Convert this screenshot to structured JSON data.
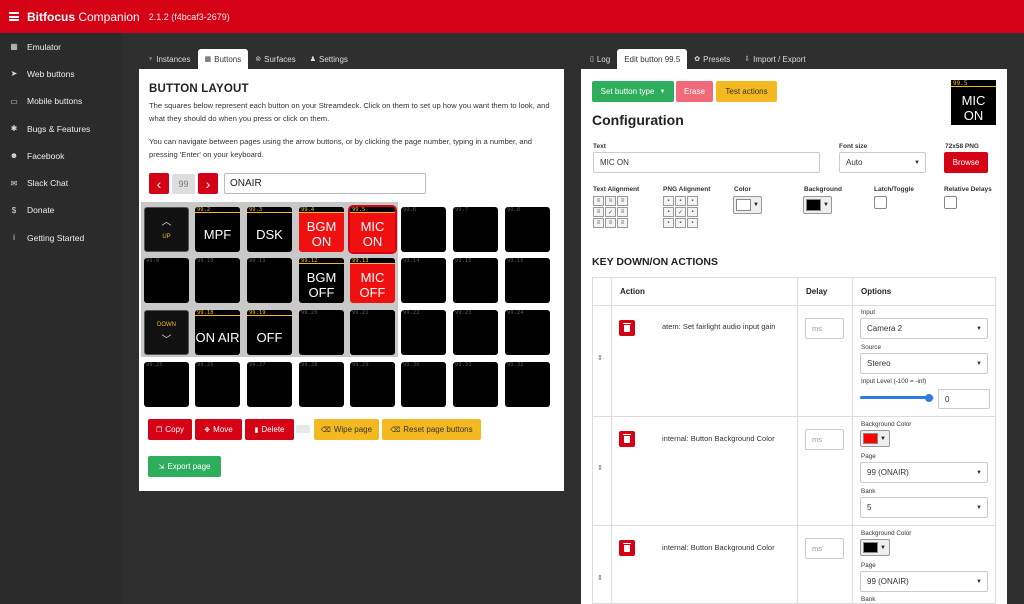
{
  "app": {
    "brand_bold": "Bitfocus",
    "brand_rest": " Companion",
    "version": "2.1.2 (f4bcaf3-2679)"
  },
  "sidebar": {
    "items": [
      {
        "label": "Emulator",
        "icon": "grid-icon",
        "glyph": "▦"
      },
      {
        "label": "Web buttons",
        "icon": "pointer-icon",
        "glyph": "➤"
      },
      {
        "label": "Mobile buttons",
        "icon": "tablet-icon",
        "glyph": "▭"
      },
      {
        "label": "Bugs & Features",
        "icon": "bug-icon",
        "glyph": "✱"
      },
      {
        "label": "Facebook",
        "icon": "users-icon",
        "glyph": "☻"
      },
      {
        "label": "Slack Chat",
        "icon": "comments-icon",
        "glyph": "✉"
      },
      {
        "label": "Donate",
        "icon": "dollar-icon",
        "glyph": "$"
      },
      {
        "label": "Getting Started",
        "icon": "info-icon",
        "glyph": "i"
      }
    ]
  },
  "left_tabs": [
    {
      "label": "Instances",
      "icon": "plug-icon",
      "glyph": "♆"
    },
    {
      "label": "Buttons",
      "icon": "calculator-icon",
      "glyph": "▦",
      "active": true
    },
    {
      "label": "Surfaces",
      "icon": "gamepad-icon",
      "glyph": "⊚"
    },
    {
      "label": "Settings",
      "icon": "user-cog-icon",
      "glyph": "♟"
    }
  ],
  "right_tabs": [
    {
      "label": "Log",
      "icon": "file-icon",
      "glyph": "▯"
    },
    {
      "label": "Edit button 99.5",
      "icon": "",
      "glyph": "",
      "active": true
    },
    {
      "label": "Presets",
      "icon": "gift-icon",
      "glyph": "✿"
    },
    {
      "label": "Import / Export",
      "icon": "download-icon",
      "glyph": "⇩"
    }
  ],
  "button_layout": {
    "title": "BUTTON LAYOUT",
    "para1": "The squares below represent each button on your Streamdeck. Click on them to set up how you want them to look, and what they should do when you press or click on them.",
    "para2": "You can navigate between pages using the arrow buttons, or by clicking the page number, typing in a number, and pressing 'Enter' on your keyboard.",
    "page_number": "99",
    "page_name": "ONAIR",
    "prev_glyph": "‹",
    "next_glyph": "›",
    "copy": "Copy",
    "move": "Move",
    "delete": "Delete",
    "wipe": "Wipe page",
    "reset": "Reset page buttons",
    "export": "Export page",
    "nav_up": "UP",
    "nav_down": "DOWN",
    "chev_up": "︿",
    "chev_down": "﹀"
  },
  "keys": [
    {
      "num": "",
      "label": "",
      "type": "nav-up"
    },
    {
      "num": "99.2",
      "label": "MPF",
      "lit": true
    },
    {
      "num": "99.3",
      "label": "DSK",
      "lit": true
    },
    {
      "num": "99.4",
      "label": "BGM ON",
      "lit": true,
      "red": true
    },
    {
      "num": "99.5",
      "label": "MIC ON",
      "lit": true,
      "red": true
    },
    {
      "num": "99.6",
      "label": ""
    },
    {
      "num": "99.7",
      "label": ""
    },
    {
      "num": "99.8",
      "label": ""
    },
    {
      "num": "99.9",
      "label": ""
    },
    {
      "num": "99.10",
      "label": ""
    },
    {
      "num": "99.11",
      "label": ""
    },
    {
      "num": "99.12",
      "label": "BGM OFF",
      "lit": true
    },
    {
      "num": "99.13",
      "label": "MIC OFF",
      "lit": true,
      "red": true
    },
    {
      "num": "99.14",
      "label": ""
    },
    {
      "num": "99.15",
      "label": ""
    },
    {
      "num": "99.16",
      "label": ""
    },
    {
      "num": "",
      "label": "",
      "type": "nav-down"
    },
    {
      "num": "99.18",
      "label": "ON AIR",
      "lit": true
    },
    {
      "num": "99.19",
      "label": "OFF",
      "lit": true
    },
    {
      "num": "99.20",
      "label": ""
    },
    {
      "num": "99.21",
      "label": ""
    },
    {
      "num": "99.22",
      "label": ""
    },
    {
      "num": "99.23",
      "label": ""
    },
    {
      "num": "99.24",
      "label": ""
    },
    {
      "num": "99.25",
      "label": ""
    },
    {
      "num": "99.26",
      "label": ""
    },
    {
      "num": "99.27",
      "label": ""
    },
    {
      "num": "99.28",
      "label": ""
    },
    {
      "num": "99.29",
      "label": ""
    },
    {
      "num": "99.30",
      "label": ""
    },
    {
      "num": "99.31",
      "label": ""
    },
    {
      "num": "99.32",
      "label": ""
    }
  ],
  "edit": {
    "set_type": "Set button type",
    "erase": "Erase",
    "test": "Test actions",
    "heading": "Configuration",
    "preview_num": "99.5",
    "preview_label": "MIC ON",
    "text_label": "Text",
    "text_value": "MIC ON",
    "font_size_label": "Font size",
    "font_size_value": "Auto",
    "png_label": "72x58 PNG",
    "browse": "Browse",
    "text_align_label": "Text Alignment",
    "png_align_label": "PNG Alignment",
    "color_label": "Color",
    "background_label": "Background",
    "latch_label": "Latch/Toggle",
    "relative_label": "Relative Delays",
    "color_value": "#ffffff",
    "background_value": "#000000",
    "actions_heading": "KEY DOWN/ON ACTIONS",
    "col_action": "Action",
    "col_delay": "Delay",
    "col_options": "Options"
  },
  "actions": [
    {
      "text": "atem: Set fairlight audio input gain",
      "delay_placeholder": "ms",
      "input_label": "Input",
      "input_value": "Camera 2",
      "source_label": "Source",
      "source_value": "Stereo",
      "level_label": "Input Level (-100 = -inf)",
      "level_value": "0",
      "level_fraction": 0.93
    },
    {
      "text": "internal: Button Background Color",
      "delay_placeholder": "ms",
      "bg_label": "Background Color",
      "bg_color": "#ff0000",
      "page_label": "Page",
      "page_value": "99 (ONAIR)",
      "bank_label": "Bank",
      "bank_value": "5"
    },
    {
      "text": "internal: Button Background Color",
      "delay_placeholder": "ms",
      "bg_label": "Background Color",
      "bg_color": "#000000",
      "page_label": "Page",
      "page_value": "99 (ONAIR)",
      "bank_label": "Bank"
    }
  ]
}
